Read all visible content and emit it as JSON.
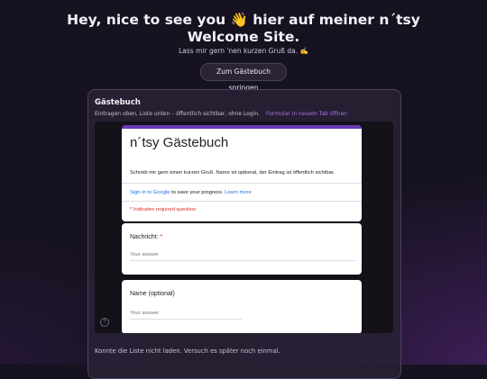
{
  "hero": {
    "title": "Hey, nice to see you 👋 hier auf meiner n´tsy Welcome Site.",
    "subtitle": "Lass mir gern 'nen kurzen Gruß da. ✍️",
    "jump_button": "Zum Gästebuch springen"
  },
  "guestbook": {
    "title": "Gästebuch",
    "description": "Eintragen oben, Liste unten – öffentlich sichtbar, ohne Login.",
    "open_link": "Formular in neuem Tab öffnen",
    "status_message": "Konnte die Liste nicht laden. Versuch es später noch einmal."
  },
  "form": {
    "title": "n´tsy Gästebuch",
    "description": "Schreib mir gern einen kurzen Gruß. Name ist optional, der Eintrag ist öffentlich sichtbar.",
    "signin_link": "Sign in to Google",
    "signin_rest": " to save your progress.",
    "learn_more": "Learn more",
    "required_note": "* Indicates required question",
    "questions": [
      {
        "label": "Nachricht:",
        "required_marker": "*",
        "placeholder": "Your answer"
      },
      {
        "label": "Name (optional)",
        "placeholder": "Your answer"
      }
    ],
    "accent_color": "#673ab7"
  },
  "help_icon": "?"
}
